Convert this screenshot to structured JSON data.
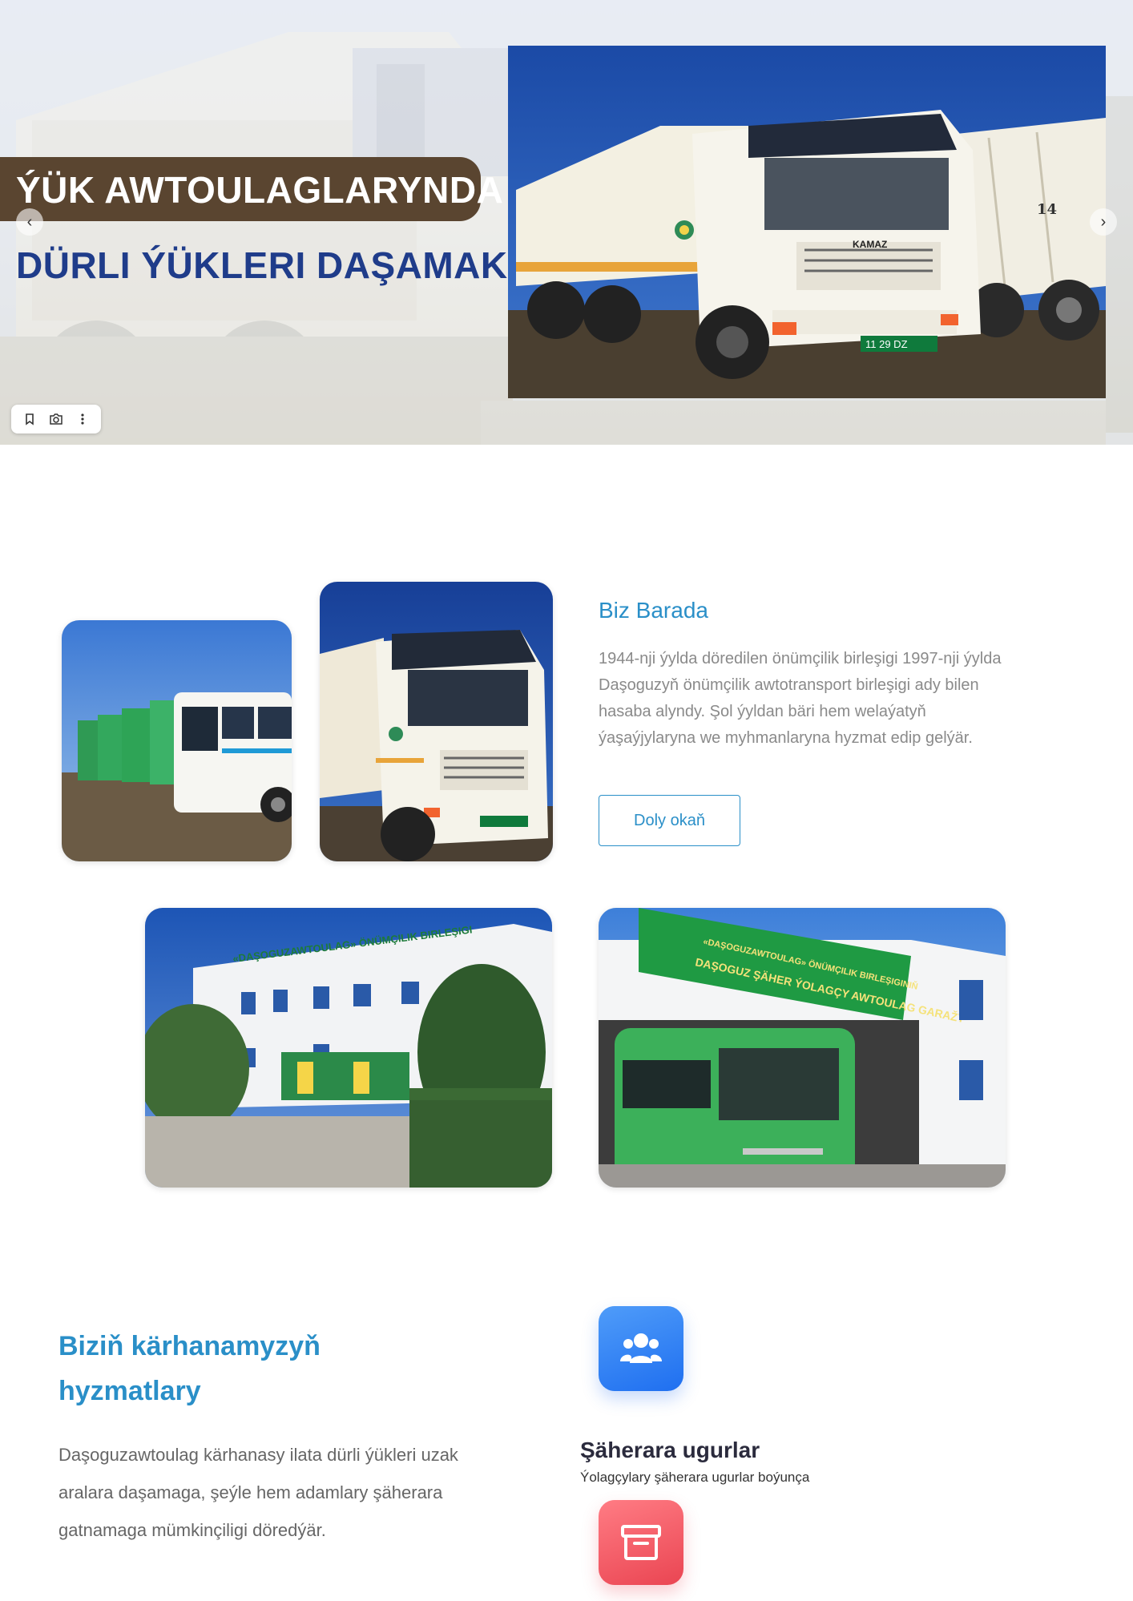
{
  "hero": {
    "line1": "ÝÜK AWTOULAGLARYNDA",
    "line2": "DÜRLI ÝÜKLERI DAŞAMAK",
    "prev_glyph": "‹",
    "next_glyph": "›",
    "plate_text": "11 29 DZ",
    "side_number": "14",
    "brand_text": "KAMAZ"
  },
  "about": {
    "title": "Biz Barada",
    "text": "1944-nji ýylda döredilen önümçilik birleşigi 1997-nji ýylda Daşoguzyň önümçilik awtotransport birleşigi ady bilen hasaba alyndy. Şol ýyldan bäri hem welaýatyň ýaşaýjylaryna we myhmanlaryna hyzmat edip gelýär.",
    "button": "Doly okaň"
  },
  "photos": {
    "bldg1_sign": "«DAŞOGUZAWTOULAG» ÖNÜMÇILIK BIRLEŞIGI",
    "bldg2_sign_top": "«DAŞOGUZAWTOULAG» ÖNÜMÇILIK BIRLEŞIGINIŇ",
    "bldg2_sign_bottom": "DAŞOGUZ ŞÄHER ÝOLAGÇY AWTOULAG GARAŽY"
  },
  "services": {
    "title": "Biziň kärhanamyzyň hyzmatlary",
    "text": "Daşoguzawtoulag kärhanasy ilata dürli ýükleri uzak aralara daşamaga, şeýle hem adamlary şäherara gatnamaga mümkinçiligi döredýär.",
    "items": [
      {
        "title": "Şäherara ugurlar",
        "desc": "Ýolagçylary şäherara ugurlar boýunça",
        "icon": "users-icon",
        "color": "#2f7ff5"
      },
      {
        "title": "",
        "desc": "",
        "icon": "archive-icon",
        "color": "#f0545f"
      }
    ]
  },
  "colors": {
    "accent": "#2a8fc8",
    "hero_banner": "#5a4530",
    "hero_blue_text": "#1f3c8a"
  }
}
